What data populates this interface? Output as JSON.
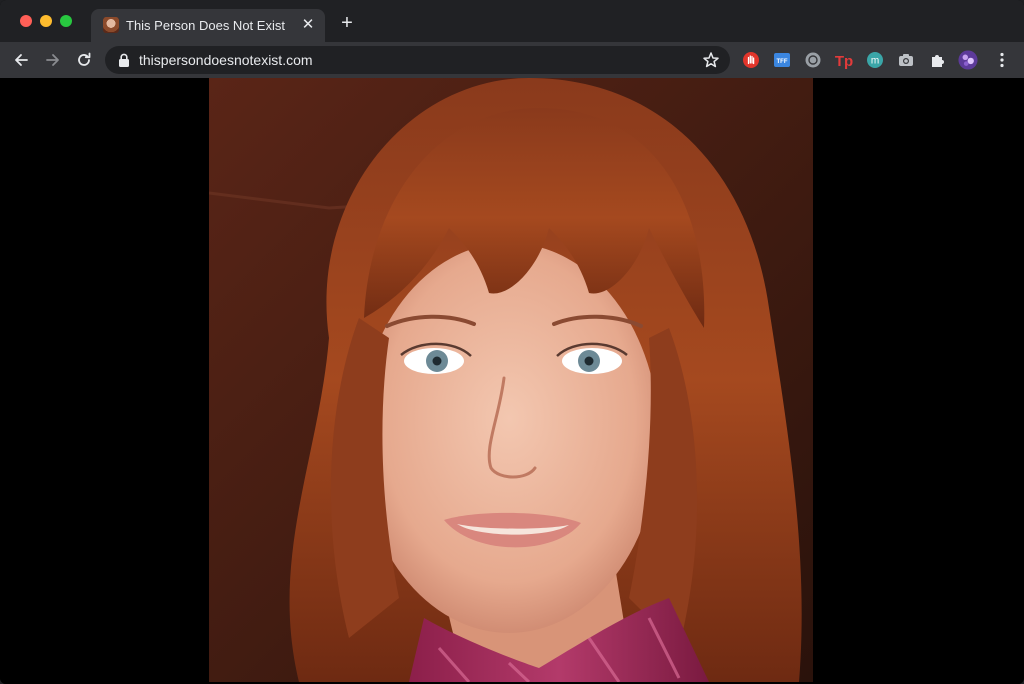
{
  "browser": {
    "tab": {
      "title": "This Person Does Not Exist",
      "close_glyph": "✕"
    },
    "new_tab_glyph": "+",
    "address_bar": {
      "url": "thispersondoesnotexist.com"
    },
    "extensions": [
      {
        "name": "hand-stop-extension-icon"
      },
      {
        "name": "tff-extension-icon",
        "label": "TFF"
      },
      {
        "name": "circle-extension-icon"
      },
      {
        "name": "tp-extension-icon",
        "label": "Tp"
      },
      {
        "name": "m-extension-icon",
        "label": "m"
      },
      {
        "name": "camera-extension-icon"
      },
      {
        "name": "puzzle-extensions-icon"
      },
      {
        "name": "profile-avatar"
      },
      {
        "name": "menu-kebab-icon"
      }
    ]
  },
  "page": {
    "image_description_role": "generated face portrait"
  },
  "colors": {
    "tabstrip": "#202124",
    "toolbar": "#35363a",
    "omnibox": "#202124",
    "text": "#e8eaed"
  }
}
